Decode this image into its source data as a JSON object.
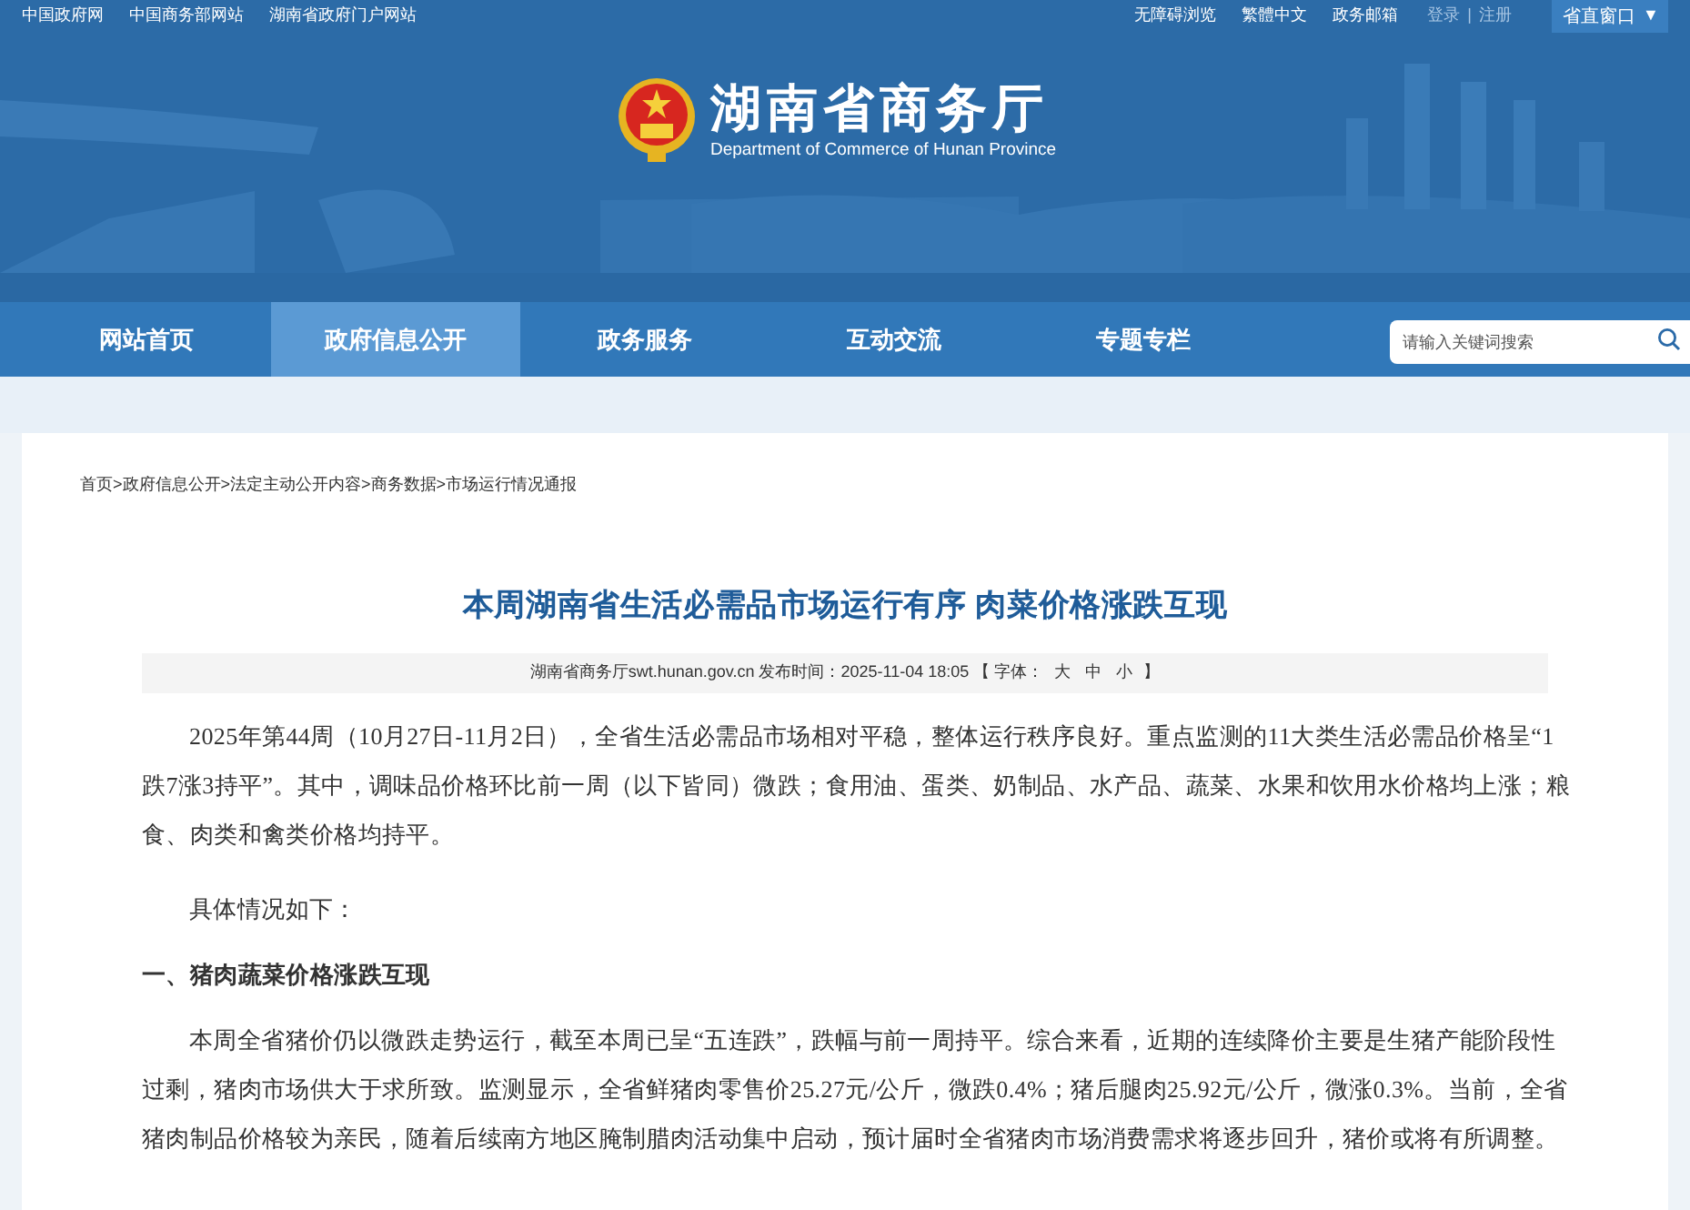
{
  "top_links": [
    "中国政府网",
    "中国商务部网站",
    "湖南省政府门户网站"
  ],
  "top_right_links": [
    "无障碍浏览",
    "繁體中文",
    "政务邮箱"
  ],
  "account_links": [
    "登录",
    "注册"
  ],
  "account_separator": "|",
  "region_menu": {
    "label": "省直窗口",
    "caret": "▼"
  },
  "site": {
    "title": "湖南省商务厅",
    "subtitle": "Department of Commerce of Hunan Province"
  },
  "nav": [
    {
      "label": "网站首页",
      "selected": false
    },
    {
      "label": "政府信息公开",
      "selected": true
    },
    {
      "label": "政务服务",
      "selected": false
    },
    {
      "label": "互动交流",
      "selected": false
    },
    {
      "label": "专题专栏",
      "selected": false
    }
  ],
  "search": {
    "placeholder": "请输入关键词搜索"
  },
  "breadcrumb": [
    "首页",
    "政府信息公开",
    "法定主动公开内容",
    "商务数据",
    "市场运行情况通报"
  ],
  "breadcrumb_separator": ">",
  "article": {
    "title": "本周湖南省生活必需品市场运行有序 肉菜价格涨跌互现",
    "meta": "湖南省商务厅swt.hunan.gov.cn 发布时间：2025-11-04 18:05 【 字体：",
    "font_sizes": [
      "大",
      "中",
      "小"
    ],
    "meta_end": "】",
    "blocks": [
      {
        "kind": "paragraph",
        "text": "2025年第44周（10月27日-11月2日），全省生活必需品市场相对平稳，整体运行秩序良好。重点监测的11大类生活必需品价格呈“1跌7涨3持平”。其中，调味品价格环比前一周（以下皆同）微跌；食用油、蛋类、奶制品、水产品、蔬菜、水果和饮用水价格均上涨；粮食、肉类和禽类价格均持平。"
      },
      {
        "kind": "paragraph",
        "text": "具体情况如下："
      },
      {
        "kind": "heading",
        "text": "一、猪肉蔬菜价格涨跌互现"
      },
      {
        "kind": "paragraph",
        "text": "本周全省猪价仍以微跌走势运行，截至本周已呈“五连跌”，跌幅与前一周持平。综合来看，近期的连续降价主要是生猪产能阶段性过剩，猪肉市场供大于求所致。监测显示，全省鲜猪肉零售价25.27元/公斤，微跌0.4%；猪后腿肉25.92元/公斤，微涨0.3%。当前，全省猪肉制品价格较为亲民，随着后续南方地区腌制腊肉活动集中启动，预计届时全省猪肉市场消费需求将逐步回升，猪价或将有所调整。"
      }
    ]
  }
}
